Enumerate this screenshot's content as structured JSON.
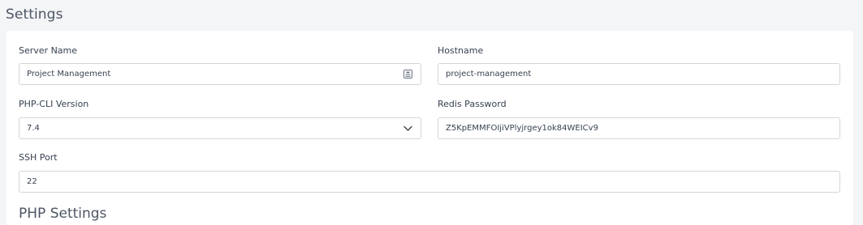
{
  "page": {
    "title": "Settings"
  },
  "form": {
    "server_name": {
      "label": "Server Name",
      "value": "Project Management",
      "icon": "id-card-icon"
    },
    "hostname": {
      "label": "Hostname",
      "value": "project-management"
    },
    "php_cli_version": {
      "label": "PHP-CLI Version",
      "value": "7.4",
      "icon": "chevron-down-icon"
    },
    "redis_password": {
      "label": "Redis Password",
      "value": "Z5KpEMMFOIjiVPlyjrgey1ok84WEICv9"
    },
    "ssh_port": {
      "label": "SSH Port",
      "value": "22"
    }
  },
  "next_section": {
    "title": "PHP Settings"
  }
}
